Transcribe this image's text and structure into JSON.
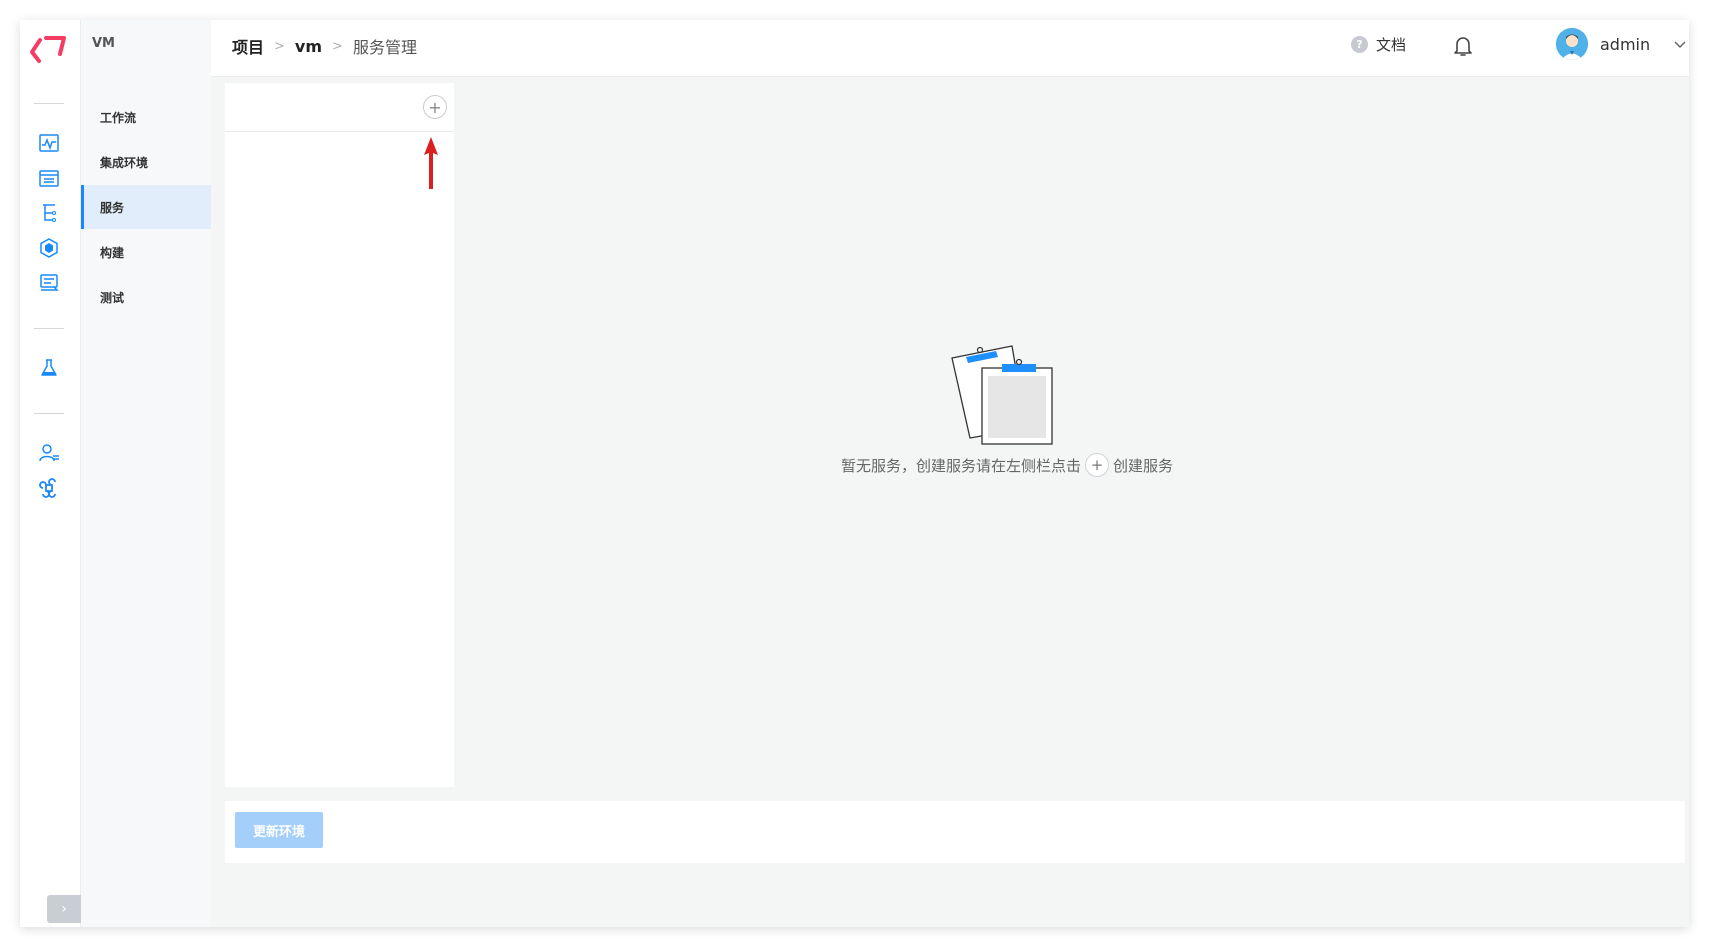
{
  "app": {
    "logo_icon": "koderover-logo-icon",
    "brand_color": "#f53d63",
    "accent_color": "#1989fa"
  },
  "rail": {
    "icons": [
      "pulse-chart-icon",
      "project-list-icon",
      "tree-structure-icon",
      "hexagon-cube-icon",
      "delivery-board-icon",
      "flask-icon",
      "user-list-icon",
      "command-icon"
    ],
    "toggle_label": "›"
  },
  "project_nav": {
    "title": "VM",
    "items": [
      {
        "label": "工作流",
        "active": false
      },
      {
        "label": "集成环境",
        "active": false
      },
      {
        "label": "服务",
        "active": true
      },
      {
        "label": "构建",
        "active": false
      },
      {
        "label": "测试",
        "active": false
      }
    ]
  },
  "header": {
    "breadcrumb": {
      "root": "项目",
      "project": "vm",
      "current": "服务管理",
      "separator": ">"
    },
    "help_icon_glyph": "?",
    "help_label": "文档",
    "username": "admin"
  },
  "services": {
    "add_glyph": "+",
    "empty_text_before": "暂无服务，创建服务请在左侧栏点击",
    "empty_text_after": "创建服务"
  },
  "footer": {
    "update_button_label": "更新环境"
  }
}
